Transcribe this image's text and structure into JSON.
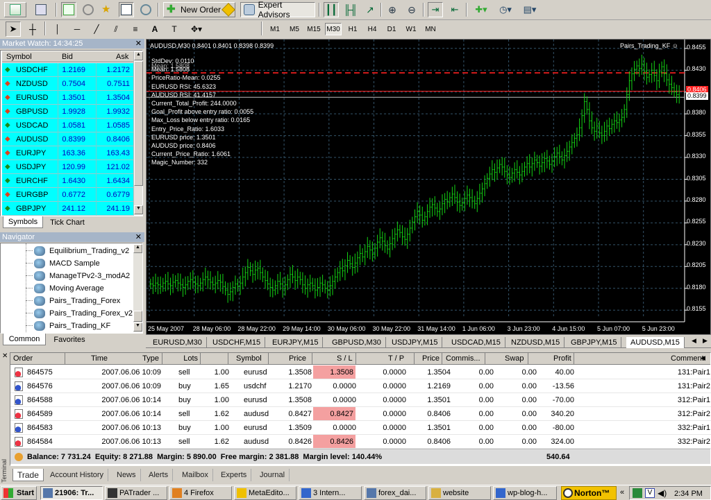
{
  "toolbar": {
    "new_order": "New Order",
    "expert_advisors": "Expert Advisors",
    "timeframes": [
      "M1",
      "M5",
      "M15",
      "M30",
      "H1",
      "H4",
      "D1",
      "W1",
      "MN"
    ],
    "active_tf": "M30"
  },
  "market_watch": {
    "title": "Market Watch: 14:34:25",
    "col_symbol": "Symbol",
    "col_bid": "Bid",
    "col_ask": "Ask",
    "rows": [
      {
        "sym": "USDCHF",
        "bid": "1.2169",
        "ask": "1.2172",
        "dir": "up"
      },
      {
        "sym": "NZDUSD",
        "bid": "0.7504",
        "ask": "0.7511",
        "dir": "down"
      },
      {
        "sym": "EURUSD",
        "bid": "1.3501",
        "ask": "1.3504",
        "dir": "down"
      },
      {
        "sym": "GBPUSD",
        "bid": "1.9928",
        "ask": "1.9932",
        "dir": "down"
      },
      {
        "sym": "USDCAD",
        "bid": "1.0581",
        "ask": "1.0585",
        "dir": "up"
      },
      {
        "sym": "AUDUSD",
        "bid": "0.8399",
        "ask": "0.8406",
        "dir": "down"
      },
      {
        "sym": "EURJPY",
        "bid": "163.36",
        "ask": "163.43",
        "dir": "down"
      },
      {
        "sym": "USDJPY",
        "bid": "120.99",
        "ask": "121.02",
        "dir": "up"
      },
      {
        "sym": "EURCHF",
        "bid": "1.6430",
        "ask": "1.6434",
        "dir": "up"
      },
      {
        "sym": "EURGBP",
        "bid": "0.6772",
        "ask": "0.6779",
        "dir": "down"
      },
      {
        "sym": "GBPJPY",
        "bid": "241.12",
        "ask": "241.19",
        "dir": "up"
      }
    ],
    "tabs": [
      "Symbols",
      "Tick Chart"
    ]
  },
  "navigator": {
    "title": "Navigator",
    "items": [
      "Equilibrium_Trading_v2",
      "MACD Sample",
      "ManageTPv2-3_modA2",
      "Moving Average",
      "Pairs_Trading_Forex",
      "Pairs_Trading_Forex_v2",
      "Pairs_Trading_KF"
    ],
    "tabs": [
      "Common",
      "Favorites"
    ]
  },
  "chart": {
    "header": "AUDUSD,M30  0.8401 0.8401 0.8398 0.8399",
    "ea_name": "Pairs_Trading_KF",
    "info_lines": [
      "StdDev: 0.0110",
      "Mean: 1.5808",
      "PriceRatio-Mean: 0.0255",
      "EURUSD RSI: 45.6323",
      "AUDUSD RSI: 41.4157",
      "Current_Total_Profit: 244.0000",
      "Goal_Profit above entry ratio: 0.0055",
      "Max_Loss below entry ratio: 0.0165",
      "Entry_Price_Ratio: 1.6033",
      "EURUSD price: 1.3501",
      "AUDUSD price: 0.8406",
      "Current_Price_Ratio: 1.6061",
      "Magic_Number: 332"
    ],
    "info_overlap": "Mean: 1.5808",
    "y_ticks": [
      "0.8455",
      "0.8430",
      "0.8405",
      "0.8380",
      "0.8355",
      "0.8330",
      "0.8305",
      "0.8280",
      "0.8255",
      "0.8230",
      "0.8205",
      "0.8180",
      "0.8155"
    ],
    "price_tag": "0.8399",
    "price_tag_red": "0.8406",
    "x_ticks": [
      "25 May 2007",
      "28 May 06:00",
      "28 May 22:00",
      "29 May 14:00",
      "30 May 06:00",
      "30 May 22:00",
      "31 May 14:00",
      "1 Jun 06:00",
      "3 Jun 23:00",
      "4 Jun 15:00",
      "5 Jun 07:00",
      "5 Jun 23:00"
    ],
    "symbol_tabs": [
      "EURUSD,M30",
      "USDCHF,M15",
      "EURJPY,M15",
      "GBPUSD,M30",
      "USDJPY,M15",
      "USDCAD,M15",
      "NZDUSD,M15",
      "GBPJPY,M15",
      "AUDUSD,M15"
    ],
    "series": [
      0.8185,
      0.8183,
      0.8186,
      0.8184,
      0.8182,
      0.8186,
      0.8188,
      0.8185,
      0.8183,
      0.8187,
      0.8189,
      0.8186,
      0.8184,
      0.8181,
      0.8184,
      0.8188,
      0.819,
      0.8187,
      0.8185,
      0.8183,
      0.8186,
      0.819,
      0.8193,
      0.819,
      0.8187,
      0.8184,
      0.8186,
      0.8189,
      0.8187,
      0.8182,
      0.8178,
      0.8173,
      0.8176,
      0.8181,
      0.8185,
      0.8182,
      0.8186,
      0.8193,
      0.8198,
      0.8204,
      0.82,
      0.8196,
      0.8201,
      0.8203,
      0.8198,
      0.8193,
      0.8189,
      0.8185,
      0.8181,
      0.8178,
      0.8183,
      0.8188,
      0.8185,
      0.818,
      0.8184,
      0.819,
      0.8196,
      0.8193,
      0.8189,
      0.8193,
      0.819,
      0.8184,
      0.818,
      0.8184,
      0.8186,
      0.8183,
      0.8178,
      0.8181,
      0.8186,
      0.8184,
      0.818,
      0.8178,
      0.8183,
      0.8188,
      0.8193,
      0.8198,
      0.8203,
      0.82,
      0.8206,
      0.8212,
      0.8208,
      0.8204,
      0.8209,
      0.8215,
      0.822,
      0.8216,
      0.8222,
      0.8228,
      0.8224,
      0.8219,
      0.8226,
      0.8233,
      0.8238,
      0.8234,
      0.8229,
      0.8225,
      0.8231,
      0.8237,
      0.8242,
      0.8247,
      0.8244,
      0.8239,
      0.8236,
      0.8242,
      0.8249,
      0.8256,
      0.8262,
      0.8268,
      0.8264,
      0.8258,
      0.8262,
      0.8268,
      0.8273,
      0.8276,
      0.8272,
      0.8268,
      0.8271,
      0.8277,
      0.8282,
      0.8279,
      0.8284,
      0.8288,
      0.8284,
      0.8279,
      0.8275,
      0.8278,
      0.8283,
      0.8287,
      0.8284,
      0.828,
      0.8277,
      0.8283,
      0.8289,
      0.8294,
      0.83,
      0.8306,
      0.8311,
      0.8316,
      0.8313,
      0.8318,
      0.8322,
      0.8319,
      0.8314,
      0.831,
      0.8307,
      0.8312,
      0.8316,
      0.8313,
      0.831,
      0.8314,
      0.8319,
      0.8323,
      0.8319,
      0.8323,
      0.8327,
      0.8324,
      0.832,
      0.8324,
      0.8329,
      0.8326,
      0.8322,
      0.8326,
      0.8331,
      0.8335,
      0.8331,
      0.8327,
      0.8332,
      0.8337,
      0.8342,
      0.8347,
      0.8352,
      0.8356,
      0.8364,
      0.8378,
      0.8394,
      0.8385,
      0.8372,
      0.8364,
      0.836,
      0.8366,
      0.8358,
      0.8355,
      0.836,
      0.8366,
      0.8363,
      0.8368,
      0.8372,
      0.837,
      0.8373,
      0.8376,
      0.8385,
      0.8402,
      0.8418,
      0.8426,
      0.8431,
      0.8435,
      0.8432,
      0.8437,
      0.8429,
      0.8422,
      0.8425,
      0.843,
      0.8424,
      0.8418,
      0.8428,
      0.8434,
      0.8426,
      0.8419,
      0.8414,
      0.841,
      0.8405,
      0.8402,
      0.8399
    ],
    "lines": [
      {
        "level": 0.8427,
        "style": "dashed",
        "color": "#ff2020"
      },
      {
        "level": 0.8406,
        "style": "solid",
        "color": "#ff2020"
      },
      {
        "level": 0.8399,
        "style": "solid",
        "color": "#c0c0c0"
      }
    ]
  },
  "orders": {
    "headers": [
      "Order",
      "Time",
      "Type",
      "Lots",
      "Symbol",
      "Price",
      "S / L",
      "T / P",
      "Price",
      "Commis...",
      "Swap",
      "Profit",
      "Comment"
    ],
    "rows": [
      [
        "864575",
        "2007.06.06 10:09",
        "sell",
        "1.00",
        "eurusd",
        "1.3508",
        "1.3508",
        "0.0000",
        "1.3504",
        "0.00",
        "0.00",
        "40.00",
        "131:Pair1"
      ],
      [
        "864576",
        "2007.06.06 10:09",
        "buy",
        "1.65",
        "usdchf",
        "1.2170",
        "0.0000",
        "0.0000",
        "1.2169",
        "0.00",
        "0.00",
        "-13.56",
        "131:Pair2"
      ],
      [
        "864588",
        "2007.06.06 10:14",
        "buy",
        "1.00",
        "eurusd",
        "1.3508",
        "0.0000",
        "0.0000",
        "1.3501",
        "0.00",
        "0.00",
        "-70.00",
        "312:Pair1"
      ],
      [
        "864589",
        "2007.06.06 10:14",
        "sell",
        "1.62",
        "audusd",
        "0.8427",
        "0.8427",
        "0.0000",
        "0.8406",
        "0.00",
        "0.00",
        "340.20",
        "312:Pair2"
      ],
      [
        "864583",
        "2007.06.06 10:13",
        "buy",
        "1.00",
        "eurusd",
        "1.3509",
        "0.0000",
        "0.0000",
        "1.3501",
        "0.00",
        "0.00",
        "-80.00",
        "332:Pair1"
      ],
      [
        "864584",
        "2007.06.06 10:13",
        "sell",
        "1.62",
        "audusd",
        "0.8426",
        "0.8426",
        "0.0000",
        "0.8406",
        "0.00",
        "0.00",
        "324.00",
        "332:Pair2"
      ]
    ],
    "balance_line": "Balance: 7 731.24  Equity: 8 271.88  Margin: 5 890.00  Free margin: 2 381.88  Margin level: 140.44%",
    "total_profit": "540.64",
    "side_label": "Terminal",
    "tabs": [
      "Trade",
      "Account History",
      "News",
      "Alerts",
      "Mailbox",
      "Experts",
      "Journal"
    ]
  },
  "taskbar": {
    "start": "Start",
    "buttons": [
      "21906: Tr...",
      "PATrader ...",
      "4 Firefox",
      "MetaEdito...",
      "3 Intern...",
      "forex_dai...",
      "website",
      "wp-blog-h..."
    ],
    "norton": "Norton™",
    "clock": "2:34 PM"
  }
}
